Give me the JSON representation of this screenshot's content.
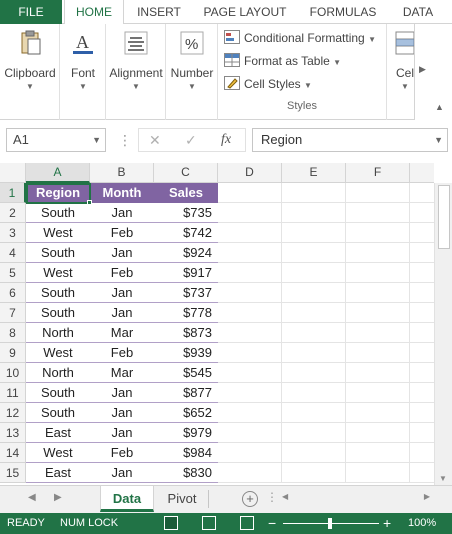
{
  "ribbon_tabs": {
    "file": "FILE",
    "home": "HOME",
    "insert": "INSERT",
    "page_layout": "PAGE LAYOUT",
    "formulas": "FORMULAS",
    "data": "DATA"
  },
  "ribbon": {
    "clipboard": "Clipboard",
    "font": "Font",
    "alignment": "Alignment",
    "number": "Number",
    "conditional_formatting": "Conditional Formatting",
    "format_as_table": "Format as Table",
    "cell_styles": "Cell Styles",
    "styles_group": "Styles",
    "cells": "Cel",
    "font_glyph": "A",
    "number_glyph": "%"
  },
  "formula_bar": {
    "name_box": "A1",
    "cancel": "✕",
    "enter": "✓",
    "fx": "fx",
    "content": "Region"
  },
  "columns": [
    "A",
    "B",
    "C",
    "D",
    "E",
    "F"
  ],
  "rows": [
    "1",
    "2",
    "3",
    "4",
    "5",
    "6",
    "7",
    "8",
    "9",
    "10",
    "11",
    "12",
    "13",
    "14",
    "15"
  ],
  "table": {
    "headers": [
      "Region",
      "Month",
      "Sales"
    ],
    "rows": [
      [
        "South",
        "Jan",
        "$735"
      ],
      [
        "West",
        "Feb",
        "$742"
      ],
      [
        "South",
        "Jan",
        "$924"
      ],
      [
        "West",
        "Feb",
        "$917"
      ],
      [
        "South",
        "Jan",
        "$737"
      ],
      [
        "South",
        "Jan",
        "$778"
      ],
      [
        "North",
        "Mar",
        "$873"
      ],
      [
        "West",
        "Feb",
        "$939"
      ],
      [
        "North",
        "Mar",
        "$545"
      ],
      [
        "South",
        "Jan",
        "$877"
      ],
      [
        "South",
        "Jan",
        "$652"
      ],
      [
        "East",
        "Jan",
        "$979"
      ],
      [
        "West",
        "Feb",
        "$984"
      ],
      [
        "East",
        "Jan",
        "$830"
      ]
    ]
  },
  "sheets": {
    "data": "Data",
    "pivot": "Pivot"
  },
  "status": {
    "ready": "READY",
    "num_lock": "NUM LOCK",
    "zoom_minus": "−",
    "zoom_plus": "+",
    "zoom": "100%"
  },
  "colors": {
    "accent": "#217346",
    "table_header": "#8064a2",
    "band_line": "#b1a0c7"
  }
}
